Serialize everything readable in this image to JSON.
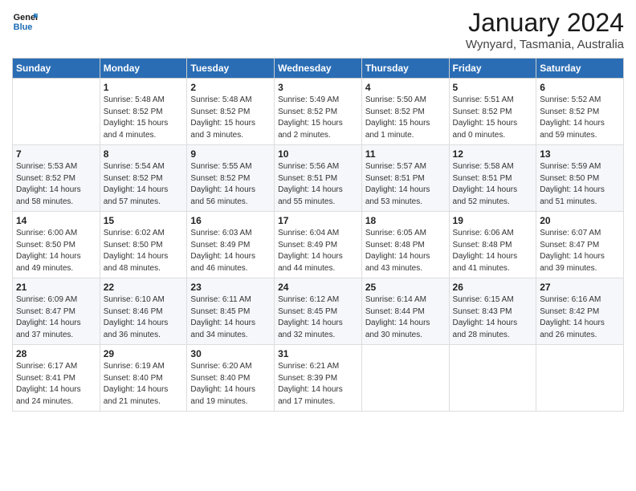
{
  "logo": {
    "line1": "General",
    "line2": "Blue"
  },
  "title": "January 2024",
  "location": "Wynyard, Tasmania, Australia",
  "days_of_week": [
    "Sunday",
    "Monday",
    "Tuesday",
    "Wednesday",
    "Thursday",
    "Friday",
    "Saturday"
  ],
  "weeks": [
    [
      {
        "day": "",
        "sunrise": "",
        "sunset": "",
        "daylight": ""
      },
      {
        "day": "1",
        "sunrise": "5:48 AM",
        "sunset": "8:52 PM",
        "daylight": "15 hours and 4 minutes."
      },
      {
        "day": "2",
        "sunrise": "5:48 AM",
        "sunset": "8:52 PM",
        "daylight": "15 hours and 3 minutes."
      },
      {
        "day": "3",
        "sunrise": "5:49 AM",
        "sunset": "8:52 PM",
        "daylight": "15 hours and 2 minutes."
      },
      {
        "day": "4",
        "sunrise": "5:50 AM",
        "sunset": "8:52 PM",
        "daylight": "15 hours and 1 minute."
      },
      {
        "day": "5",
        "sunrise": "5:51 AM",
        "sunset": "8:52 PM",
        "daylight": "15 hours and 0 minutes."
      },
      {
        "day": "6",
        "sunrise": "5:52 AM",
        "sunset": "8:52 PM",
        "daylight": "14 hours and 59 minutes."
      }
    ],
    [
      {
        "day": "7",
        "sunrise": "5:53 AM",
        "sunset": "8:52 PM",
        "daylight": "14 hours and 58 minutes."
      },
      {
        "day": "8",
        "sunrise": "5:54 AM",
        "sunset": "8:52 PM",
        "daylight": "14 hours and 57 minutes."
      },
      {
        "day": "9",
        "sunrise": "5:55 AM",
        "sunset": "8:52 PM",
        "daylight": "14 hours and 56 minutes."
      },
      {
        "day": "10",
        "sunrise": "5:56 AM",
        "sunset": "8:51 PM",
        "daylight": "14 hours and 55 minutes."
      },
      {
        "day": "11",
        "sunrise": "5:57 AM",
        "sunset": "8:51 PM",
        "daylight": "14 hours and 53 minutes."
      },
      {
        "day": "12",
        "sunrise": "5:58 AM",
        "sunset": "8:51 PM",
        "daylight": "14 hours and 52 minutes."
      },
      {
        "day": "13",
        "sunrise": "5:59 AM",
        "sunset": "8:50 PM",
        "daylight": "14 hours and 51 minutes."
      }
    ],
    [
      {
        "day": "14",
        "sunrise": "6:00 AM",
        "sunset": "8:50 PM",
        "daylight": "14 hours and 49 minutes."
      },
      {
        "day": "15",
        "sunrise": "6:02 AM",
        "sunset": "8:50 PM",
        "daylight": "14 hours and 48 minutes."
      },
      {
        "day": "16",
        "sunrise": "6:03 AM",
        "sunset": "8:49 PM",
        "daylight": "14 hours and 46 minutes."
      },
      {
        "day": "17",
        "sunrise": "6:04 AM",
        "sunset": "8:49 PM",
        "daylight": "14 hours and 44 minutes."
      },
      {
        "day": "18",
        "sunrise": "6:05 AM",
        "sunset": "8:48 PM",
        "daylight": "14 hours and 43 minutes."
      },
      {
        "day": "19",
        "sunrise": "6:06 AM",
        "sunset": "8:48 PM",
        "daylight": "14 hours and 41 minutes."
      },
      {
        "day": "20",
        "sunrise": "6:07 AM",
        "sunset": "8:47 PM",
        "daylight": "14 hours and 39 minutes."
      }
    ],
    [
      {
        "day": "21",
        "sunrise": "6:09 AM",
        "sunset": "8:47 PM",
        "daylight": "14 hours and 37 minutes."
      },
      {
        "day": "22",
        "sunrise": "6:10 AM",
        "sunset": "8:46 PM",
        "daylight": "14 hours and 36 minutes."
      },
      {
        "day": "23",
        "sunrise": "6:11 AM",
        "sunset": "8:45 PM",
        "daylight": "14 hours and 34 minutes."
      },
      {
        "day": "24",
        "sunrise": "6:12 AM",
        "sunset": "8:45 PM",
        "daylight": "14 hours and 32 minutes."
      },
      {
        "day": "25",
        "sunrise": "6:14 AM",
        "sunset": "8:44 PM",
        "daylight": "14 hours and 30 minutes."
      },
      {
        "day": "26",
        "sunrise": "6:15 AM",
        "sunset": "8:43 PM",
        "daylight": "14 hours and 28 minutes."
      },
      {
        "day": "27",
        "sunrise": "6:16 AM",
        "sunset": "8:42 PM",
        "daylight": "14 hours and 26 minutes."
      }
    ],
    [
      {
        "day": "28",
        "sunrise": "6:17 AM",
        "sunset": "8:41 PM",
        "daylight": "14 hours and 24 minutes."
      },
      {
        "day": "29",
        "sunrise": "6:19 AM",
        "sunset": "8:40 PM",
        "daylight": "14 hours and 21 minutes."
      },
      {
        "day": "30",
        "sunrise": "6:20 AM",
        "sunset": "8:40 PM",
        "daylight": "14 hours and 19 minutes."
      },
      {
        "day": "31",
        "sunrise": "6:21 AM",
        "sunset": "8:39 PM",
        "daylight": "14 hours and 17 minutes."
      },
      {
        "day": "",
        "sunrise": "",
        "sunset": "",
        "daylight": ""
      },
      {
        "day": "",
        "sunrise": "",
        "sunset": "",
        "daylight": ""
      },
      {
        "day": "",
        "sunrise": "",
        "sunset": "",
        "daylight": ""
      }
    ]
  ],
  "labels": {
    "sunrise": "Sunrise:",
    "sunset": "Sunset:",
    "daylight": "Daylight:"
  }
}
